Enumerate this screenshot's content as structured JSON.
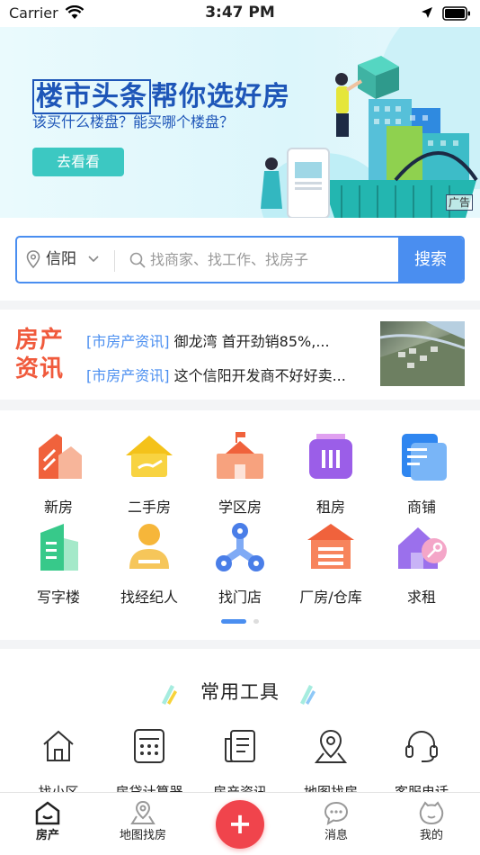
{
  "status_bar": {
    "carrier": "Carrier",
    "time": "3:47 PM"
  },
  "banner": {
    "headline_a": "楼市头条",
    "headline_b": "帮你选好房",
    "subtitle": "该买什么楼盘？能买哪个楼盘？",
    "cta": "去看看",
    "ad_label": "广告"
  },
  "search": {
    "city": "信阳",
    "placeholder": "找商家、找工作、找房子",
    "button": "搜索"
  },
  "news": {
    "logo_line1": "房产",
    "logo_line2": "资讯",
    "items": [
      {
        "tag": "[市房产资讯]",
        "text": "御龙湾 首开劲销85%,..."
      },
      {
        "tag": "[市房产资讯]",
        "text": "这个信阳开发商不好好卖..."
      }
    ]
  },
  "categories": [
    {
      "label": "新房",
      "icon": "new-house-icon"
    },
    {
      "label": "二手房",
      "icon": "second-hand-house-icon"
    },
    {
      "label": "学区房",
      "icon": "school-district-icon"
    },
    {
      "label": "租房",
      "icon": "rental-icon"
    },
    {
      "label": "商铺",
      "icon": "shop-icon"
    },
    {
      "label": "写字楼",
      "icon": "office-building-icon"
    },
    {
      "label": "找经纪人",
      "icon": "agent-icon"
    },
    {
      "label": "找门店",
      "icon": "store-icon"
    },
    {
      "label": "厂房/仓库",
      "icon": "warehouse-icon"
    },
    {
      "label": "求租",
      "icon": "wanted-rent-icon"
    }
  ],
  "tools": {
    "title": "常用工具",
    "items": [
      {
        "label": "找小区",
        "icon": "community-icon"
      },
      {
        "label": "房贷计算器",
        "icon": "calculator-icon"
      },
      {
        "label": "房产资讯",
        "icon": "news-icon"
      },
      {
        "label": "地图找房",
        "icon": "map-pin-icon"
      },
      {
        "label": "客服电话",
        "icon": "headset-icon"
      }
    ]
  },
  "tabbar": {
    "items": [
      {
        "label": "房产",
        "icon": "home-icon"
      },
      {
        "label": "地图找房",
        "icon": "map-icon"
      },
      {
        "label": "",
        "icon": "plus-icon"
      },
      {
        "label": "消息",
        "icon": "message-icon"
      },
      {
        "label": "我的",
        "icon": "profile-icon"
      }
    ]
  },
  "colors": {
    "accent": "#4a8ef0",
    "news_logo": "#f05a3c",
    "fab": "#f0444c",
    "banner_cta": "#3cc8c2"
  }
}
